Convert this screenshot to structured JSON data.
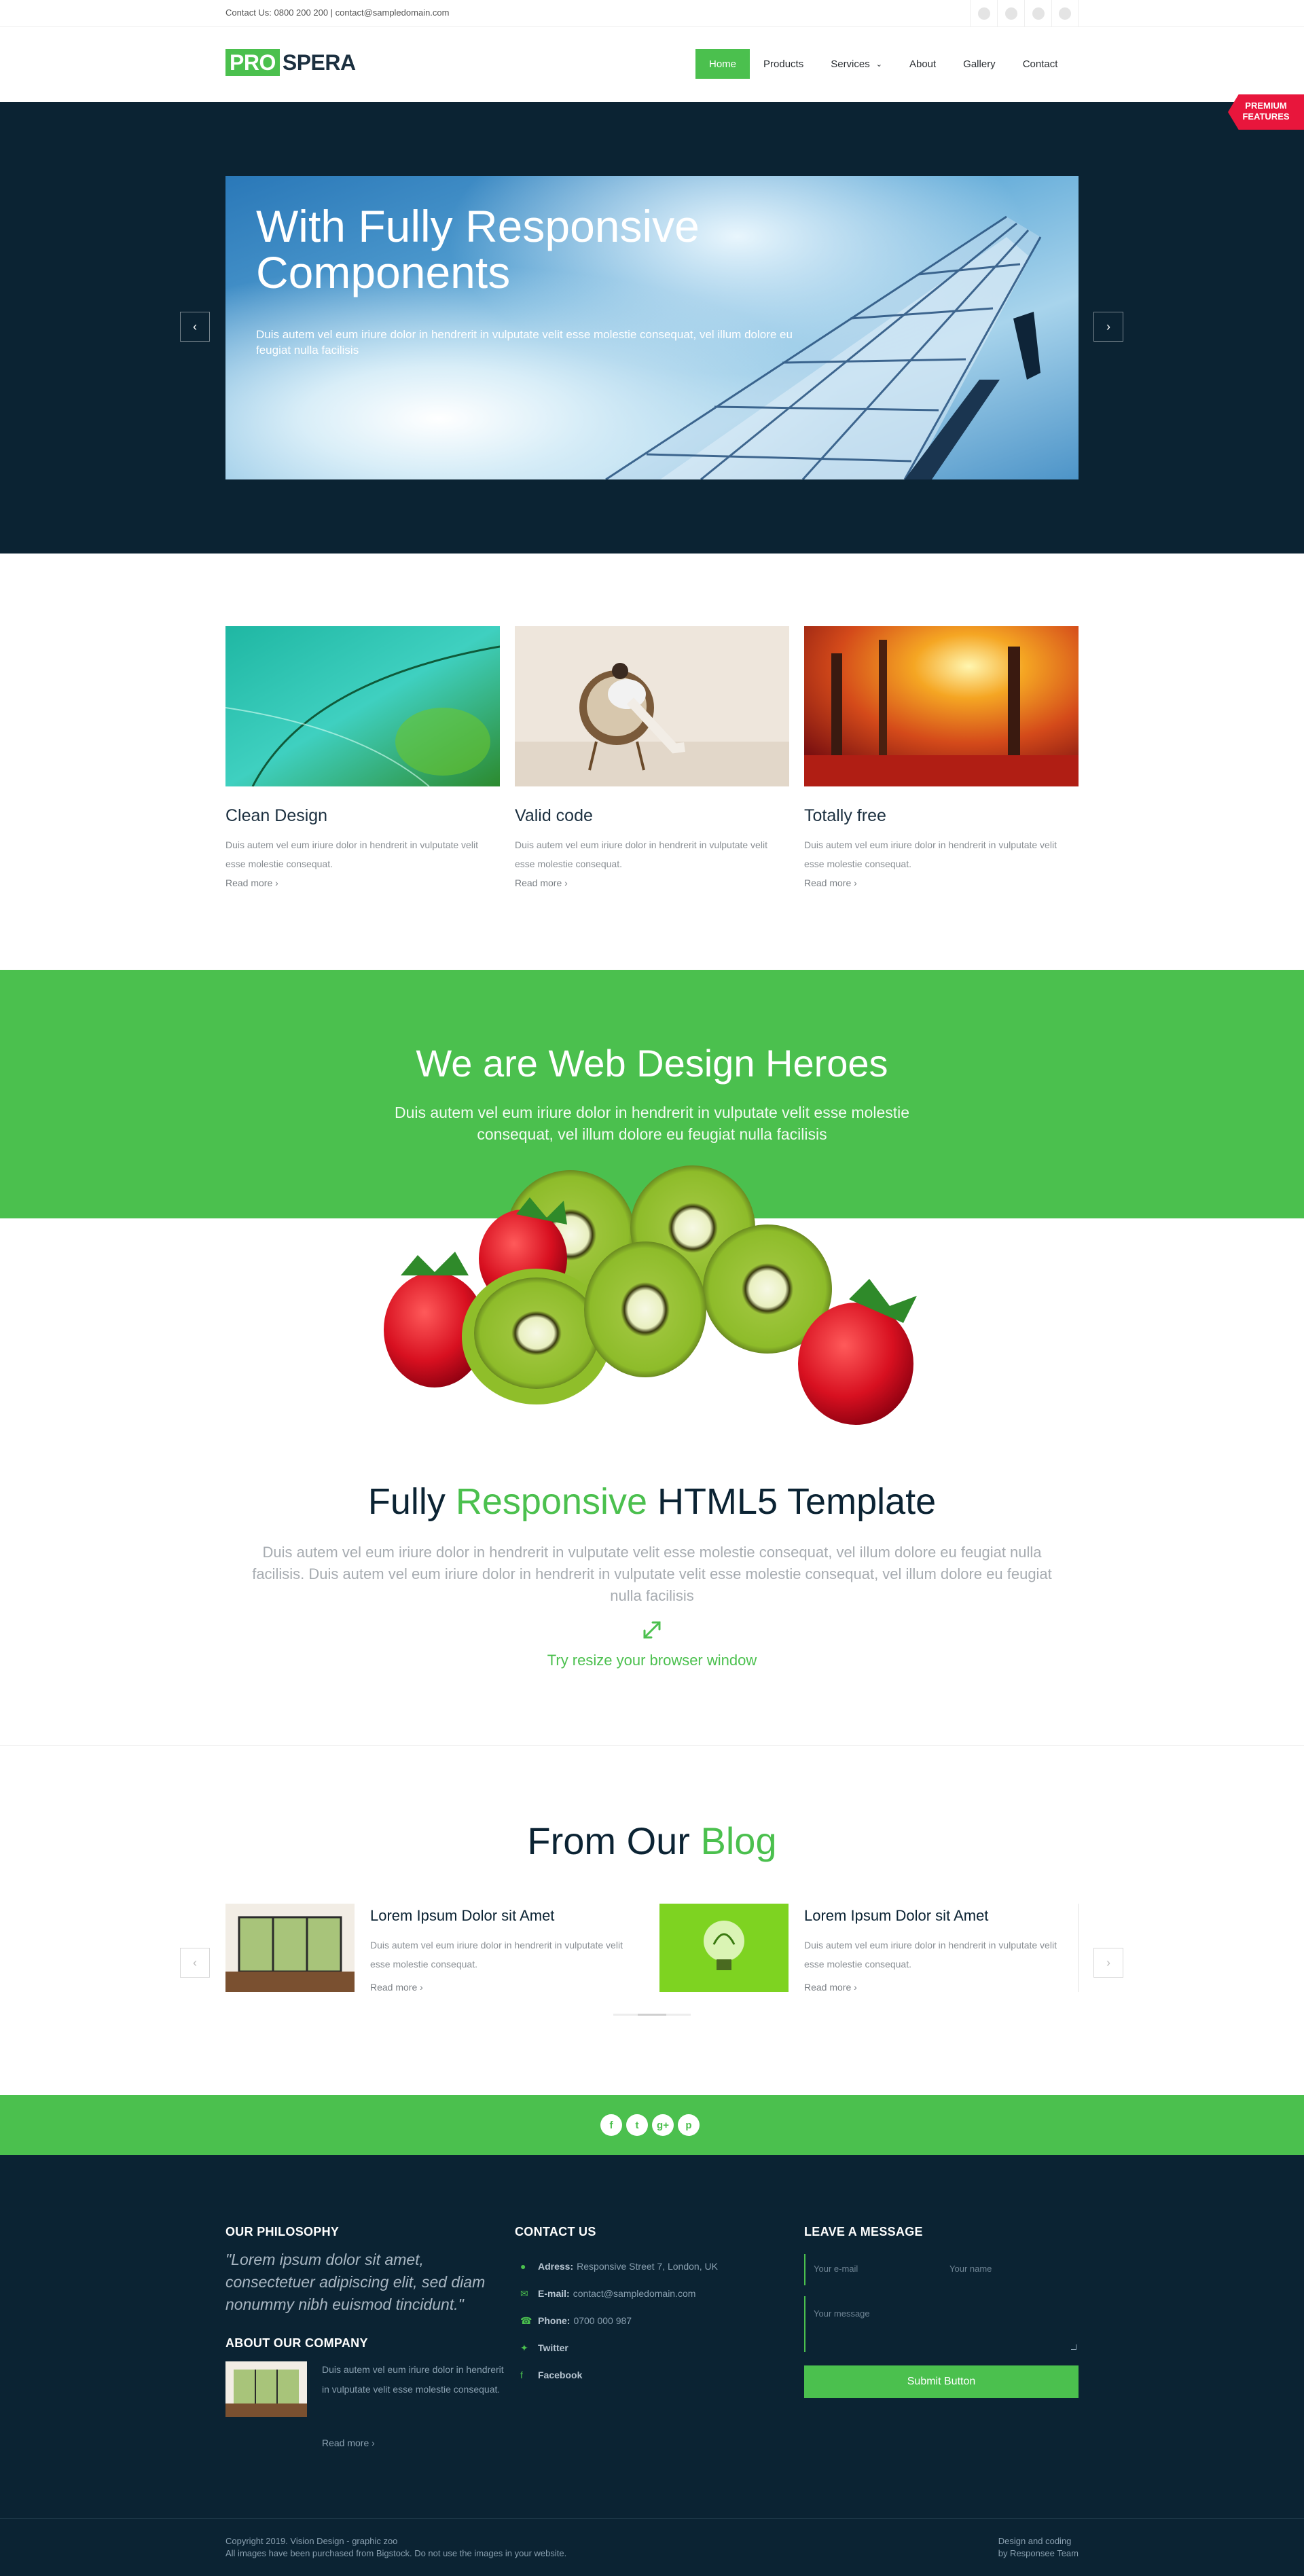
{
  "topbar": {
    "contact": "Contact Us: 0800 200 200 | contact@sampledomain.com",
    "social_icons": [
      "social-icon-1",
      "social-icon-2",
      "social-icon-3",
      "social-icon-4"
    ]
  },
  "header": {
    "logo_pro": "PRO",
    "logo_spera": "SPERA",
    "nav": [
      "Home",
      "Products",
      "Services",
      "About",
      "Gallery",
      "Contact"
    ],
    "active_nav": "Home"
  },
  "ribbon": {
    "line1": "PREMIUM",
    "line2": "FEATURES"
  },
  "hero": {
    "title_line1": "With Fully Responsive",
    "title_line2": "Components",
    "text": "Duis autem vel eum iriure dolor in hendrerit in vulputate velit esse molestie consequat, vel illum dolore eu feugiat nulla facilisis"
  },
  "features": [
    {
      "title": "Clean Design",
      "text": "Duis autem vel eum iriure dolor in hendrerit in vulputate velit esse molestie consequat.",
      "more": "Read more"
    },
    {
      "title": "Valid code",
      "text": "Duis autem vel eum iriure dolor in hendrerit in vulputate velit esse molestie consequat.",
      "more": "Read more"
    },
    {
      "title": "Totally free",
      "text": "Duis autem vel eum iriure dolor in hendrerit in vulputate velit esse molestie consequat.",
      "more": "Read more"
    }
  ],
  "heroes": {
    "title": "We are Web Design Heroes",
    "text": "Duis autem vel eum iriure dolor in hendrerit in vulputate velit esse molestie consequat, vel illum dolore eu feugiat nulla facilisis"
  },
  "responsive": {
    "title_a": "Fully ",
    "title_b": "Responsive",
    "title_c": " HTML5 Template",
    "text": "Duis autem vel eum iriure dolor in hendrerit in vulputate velit esse molestie consequat, vel illum dolore eu feugiat nulla facilisis. Duis autem vel eum iriure dolor in hendrerit in vulputate velit esse molestie consequat, vel illum dolore eu feugiat nulla facilisis",
    "try": "Try resize your browser window"
  },
  "blog": {
    "title_a": "From Our ",
    "title_b": "Blog",
    "posts": [
      {
        "title": "Lorem Ipsum Dolor sit Amet",
        "text": "Duis autem vel eum iriure dolor in hendrerit in vulputate velit esse molestie consequat.",
        "more": "Read more"
      },
      {
        "title": "Lorem Ipsum Dolor sit Amet",
        "text": "Duis autem vel eum iriure dolor in hendrerit in vulputate velit esse molestie consequat.",
        "more": "Read more"
      }
    ]
  },
  "social_strip": {
    "icons": [
      "f",
      "t",
      "g+",
      "p"
    ]
  },
  "footer": {
    "philosophy_title": "OUR PHILOSOPHY",
    "philosophy_quote": "\"Lorem ipsum dolor sit amet, consectetuer adipiscing elit, sed diam nonummy nibh euismod tincidunt.\"",
    "about_title": "ABOUT OUR COMPANY",
    "about_text": "Duis autem vel eum iriure dolor in hendrerit in vulputate velit esse molestie consequat.",
    "about_more": "Read more",
    "contact_title": "CONTACT US",
    "address_label": "Adress:",
    "address": "Responsive Street 7, London, UK",
    "email_label": "E-mail:",
    "email": "contact@sampledomain.com",
    "phone_label": "Phone:",
    "phone": "0700 000 987",
    "twitter": "Twitter",
    "facebook": "Facebook",
    "message_title": "LEAVE A MESSAGE",
    "email_placeholder": "Your e-mail",
    "name_placeholder": "Your name",
    "message_placeholder": "Your message",
    "submit": "Submit Button",
    "copyright_1": "Copyright 2019. Vision Design - graphic zoo",
    "copyright_2": "All images have been purchased from Bigstock. Do not use the images in your website.",
    "credit_1": "Design and coding",
    "credit_2": "by Responsee Team"
  },
  "colors": {
    "accent": "#4bc04e",
    "dark": "#0b2333",
    "ribbon": "#e8163c"
  }
}
